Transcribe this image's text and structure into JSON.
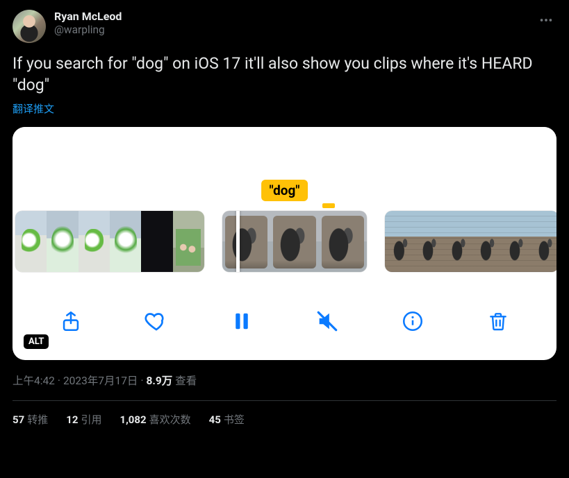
{
  "author": {
    "display_name": "Ryan McLeod",
    "handle": "@warpling"
  },
  "tweet_text": "If you search for \"dog\" on iOS 17 it'll also show you clips where it's HEARD \"dog\"",
  "translate_label": "翻译推文",
  "media": {
    "search_tag": "\"dog\"",
    "alt_badge": "ALT"
  },
  "meta": {
    "time": "上午4:42",
    "date": "2023年7月17日",
    "views_number": "8.9万",
    "views_label": "查看"
  },
  "stats": {
    "retweets": {
      "count": "57",
      "label": "转推"
    },
    "quotes": {
      "count": "12",
      "label": "引用"
    },
    "likes": {
      "count": "1,082",
      "label": "喜欢次数"
    },
    "bookmarks": {
      "count": "45",
      "label": "书签"
    }
  }
}
